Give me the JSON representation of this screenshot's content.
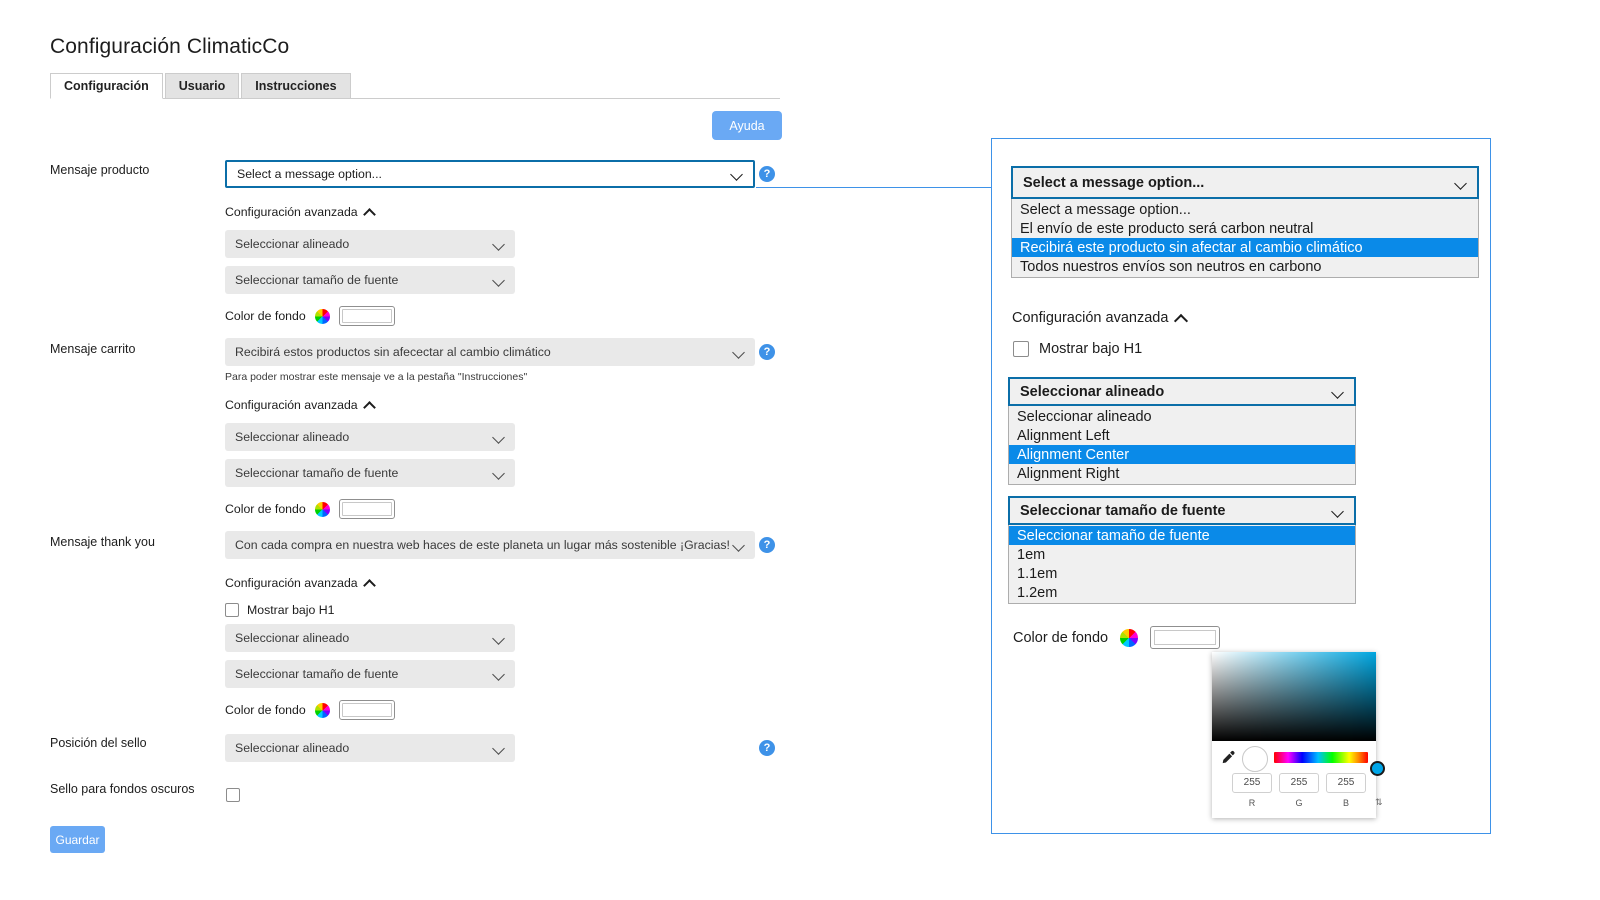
{
  "page": {
    "title": "Configuración ClimaticCo",
    "help_button": "Ayuda",
    "save_button": "Guardar"
  },
  "tabs": [
    {
      "label": "Configuración",
      "active": true
    },
    {
      "label": "Usuario",
      "active": false
    },
    {
      "label": "Instrucciones",
      "active": false
    }
  ],
  "labels": {
    "advanced": "Configuración avanzada",
    "color_bg": "Color de fondo",
    "show_under_h1": "Mostrar bajo H1",
    "placeholder_alignment": "Seleccionar alineado",
    "placeholder_fontsize": "Seleccionar tamaño de fuente",
    "help_glyph": "?"
  },
  "sections": {
    "product": {
      "label": "Mensaje producto",
      "message_value": "Select a message option...",
      "alignment_value": "Seleccionar alineado",
      "fontsize_value": "Seleccionar tamaño de fuente",
      "color_label": "Color de fondo",
      "advanced_label": "Configuración avanzada"
    },
    "cart": {
      "label": "Mensaje carrito",
      "message_value": "Recibirá estos productos sin afecectar al cambio climático",
      "hint": "Para poder mostrar este mensaje ve a la pestaña \"Instrucciones\"",
      "alignment_value": "Seleccionar alineado",
      "fontsize_value": "Seleccionar tamaño de fuente",
      "color_label": "Color de fondo",
      "advanced_label": "Configuración avanzada"
    },
    "thankyou": {
      "label": "Mensaje thank you",
      "message_value": "Con cada compra en nuestra web haces de este planeta un lugar más sostenible ¡Gracias!",
      "checkbox_label": "Mostrar bajo H1",
      "alignment_value": "Seleccionar alineado",
      "fontsize_value": "Seleccionar tamaño de fuente",
      "color_label": "Color de fondo",
      "advanced_label": "Configuración avanzada"
    },
    "stamp_position": {
      "label": "Posición del sello",
      "value": "Seleccionar alineado"
    },
    "dark_stamp": {
      "label": "Sello para fondos oscuros"
    }
  },
  "detail_panel": {
    "message_select": {
      "value": "Select a message option...",
      "options": [
        {
          "label": "Select a message option...",
          "selected": false
        },
        {
          "label": "El envío de este producto será carbon neutral",
          "selected": false
        },
        {
          "label": "Recibirá este producto sin afectar al cambio climático",
          "selected": true
        },
        {
          "label": "Todos nuestros envíos son neutros en carbono",
          "selected": false
        }
      ]
    },
    "advanced_label": "Configuración avanzada",
    "checkbox_label": "Mostrar bajo H1",
    "alignment_select": {
      "value": "Seleccionar alineado",
      "options": [
        {
          "label": "Seleccionar alineado",
          "selected": false
        },
        {
          "label": "Alignment Left",
          "selected": false
        },
        {
          "label": "Alignment Center",
          "selected": true
        },
        {
          "label": "Alignment Right",
          "selected": false
        }
      ]
    },
    "fontsize_select": {
      "value": "Seleccionar tamaño de fuente",
      "options": [
        {
          "label": "Seleccionar tamaño de fuente",
          "selected": true
        },
        {
          "label": "1em",
          "selected": false
        },
        {
          "label": "1.1em",
          "selected": false
        },
        {
          "label": "1.2em",
          "selected": false
        }
      ]
    },
    "color_label": "Color de fondo",
    "color_picker": {
      "r_value": "255",
      "g_value": "255",
      "b_value": "255",
      "r_label": "R",
      "g_label": "G",
      "b_label": "B",
      "spinner_glyph": "⇅"
    }
  },
  "colors": {
    "accent_blue": "#3e92e8",
    "focus_blue": "#0b6ea8",
    "highlight_blue": "#0a8ae8",
    "button_blue": "#6aa9f4",
    "field_gray": "#e9e9e9"
  }
}
